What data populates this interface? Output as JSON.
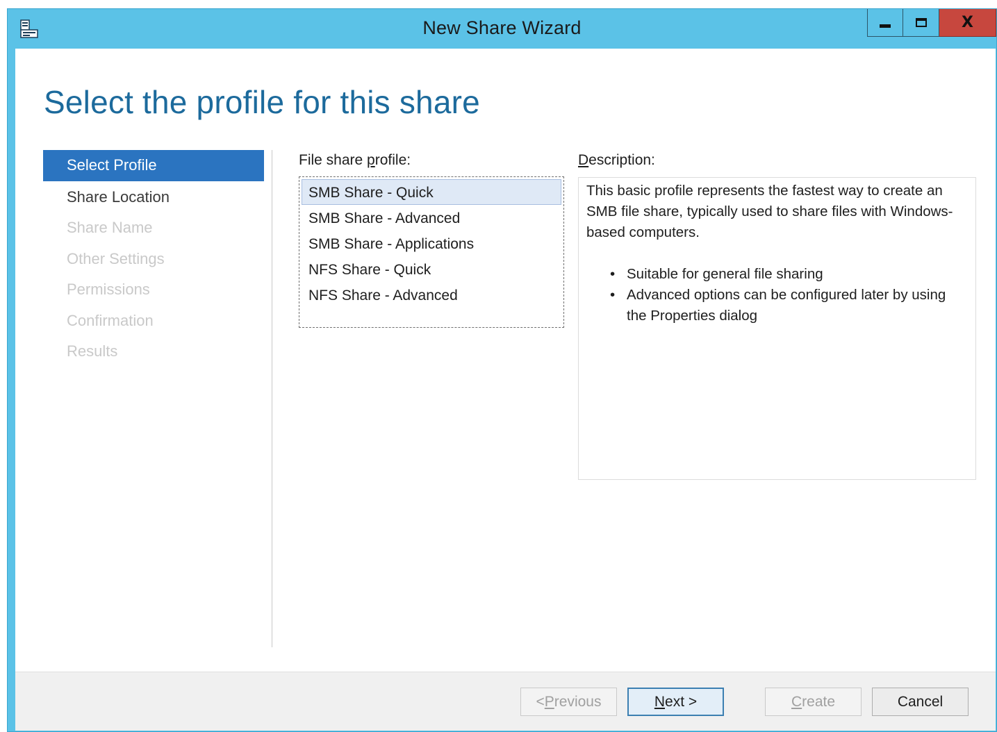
{
  "window": {
    "title": "New Share Wizard",
    "app_icon": "server-share-icon",
    "controls": {
      "minimize": "minimize-icon",
      "maximize": "maximize-icon",
      "close_glyph": "X"
    }
  },
  "page": {
    "title": "Select the profile for this share"
  },
  "steps": [
    {
      "label": "Select Profile",
      "state": "active"
    },
    {
      "label": "Share Location",
      "state": "enabled"
    },
    {
      "label": "Share Name",
      "state": "disabled"
    },
    {
      "label": "Other Settings",
      "state": "disabled"
    },
    {
      "label": "Permissions",
      "state": "disabled"
    },
    {
      "label": "Confirmation",
      "state": "disabled"
    },
    {
      "label": "Results",
      "state": "disabled"
    }
  ],
  "profile": {
    "label_pre": "File share ",
    "label_underlined": "p",
    "label_post": "rofile:",
    "items": [
      "SMB Share - Quick",
      "SMB Share - Advanced",
      "SMB Share - Applications",
      "NFS Share - Quick",
      "NFS Share - Advanced"
    ],
    "selected": "SMB Share - Quick"
  },
  "description": {
    "label_underlined": "D",
    "label_post": "escription:",
    "text": "This basic profile represents the fastest way to create an SMB file share, typically used to share files with Windows-based computers.",
    "bullets": [
      "Suitable for general file sharing",
      "Advanced options can be configured later by using the Properties dialog"
    ]
  },
  "buttons": {
    "previous": {
      "pre": "< ",
      "underlined": "P",
      "post": "revious"
    },
    "next": {
      "underlined": "N",
      "post": "ext >"
    },
    "create": {
      "underlined": "C",
      "post": "reate"
    },
    "cancel": "Cancel"
  },
  "colors": {
    "title_bar": "#5bc2e7",
    "close_button": "#c7473e",
    "active_step": "#2b74c0",
    "page_title": "#1c6a9c",
    "selected_item": "#dfe9f6"
  }
}
